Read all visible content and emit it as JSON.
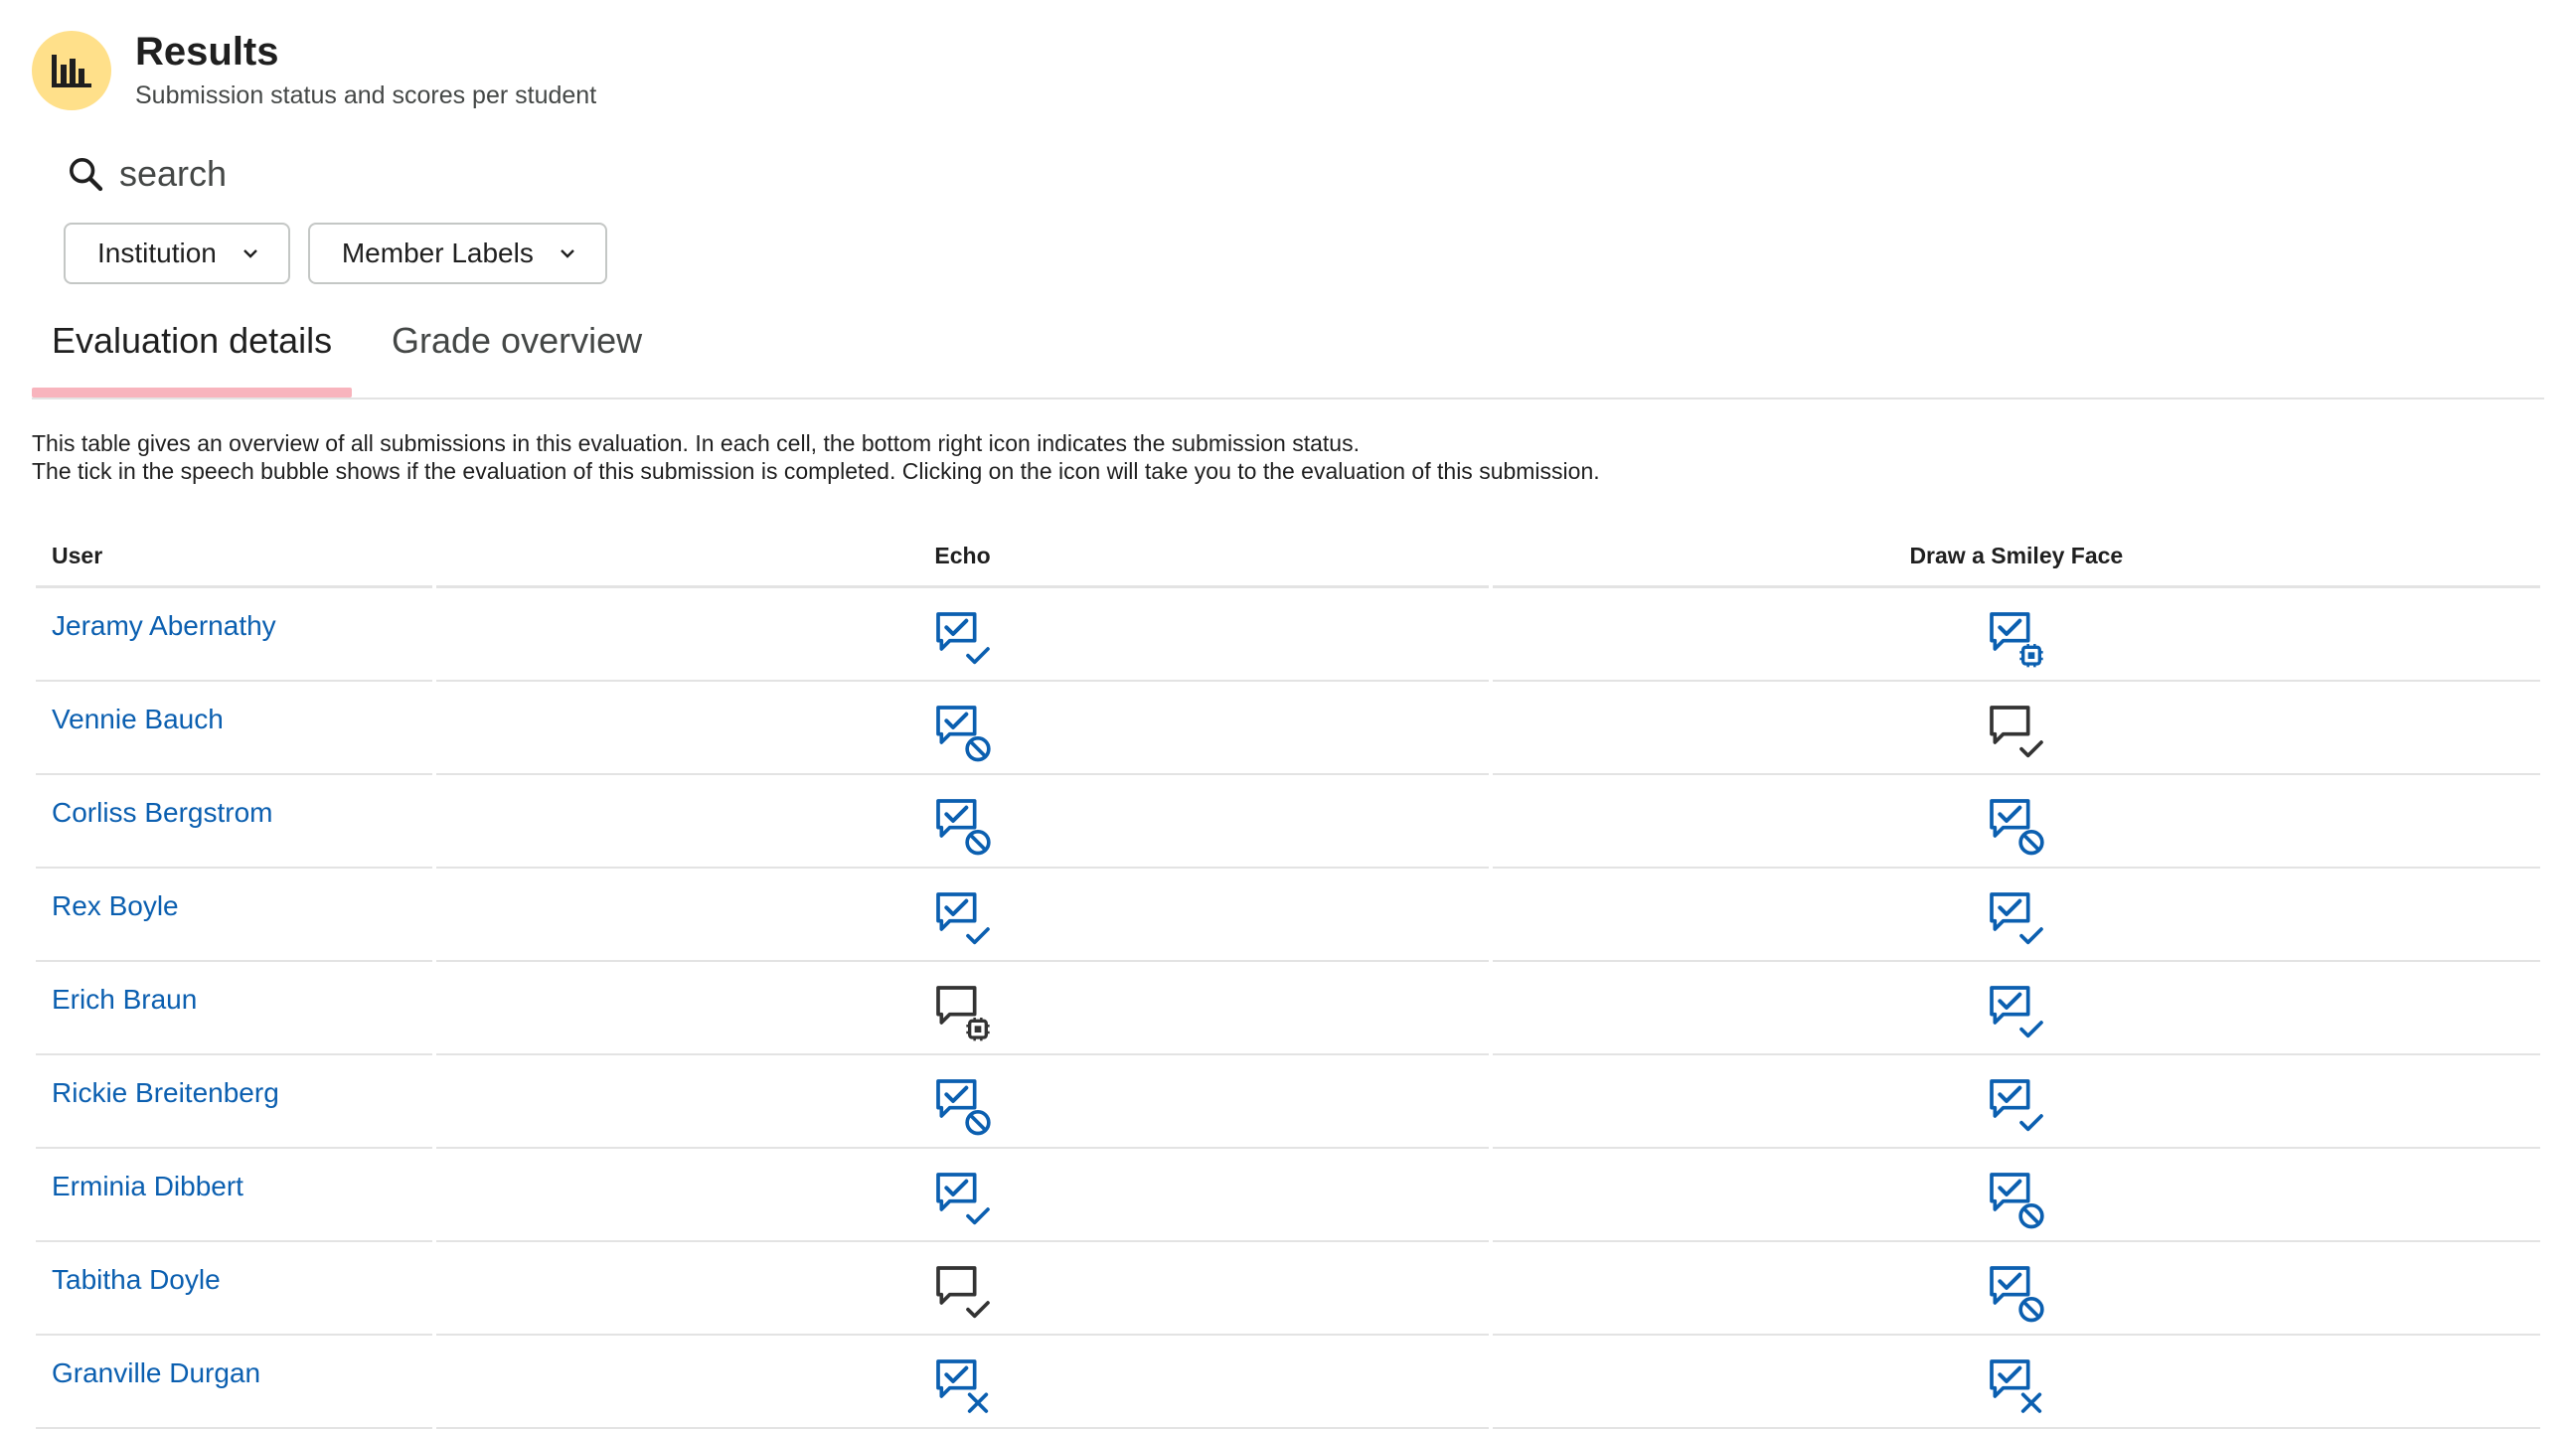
{
  "header": {
    "title": "Results",
    "subtitle": "Submission status and scores per student",
    "icon": "bar-chart-icon",
    "icon_bg": "#ffe08a"
  },
  "search": {
    "placeholder": "search"
  },
  "filters": [
    {
      "label": "Institution"
    },
    {
      "label": "Member Labels"
    }
  ],
  "tabs": [
    {
      "label": "Evaluation details",
      "active": true
    },
    {
      "label": "Grade overview",
      "active": false
    }
  ],
  "description": {
    "line1": "This table gives an overview of all submissions in this evaluation. In each cell, the bottom right icon indicates the submission status.",
    "line2": "The tick in the speech bubble shows if the evaluation of this submission is completed. Clicking on the icon will take you to the evaluation of this submission."
  },
  "table": {
    "columns": [
      "User",
      "Echo",
      "Draw a Smiley Face"
    ],
    "rows": [
      {
        "user": "Jeramy Abernathy",
        "echo": {
          "completed": true,
          "status": "correct"
        },
        "draw": {
          "completed": true,
          "status": "running"
        }
      },
      {
        "user": "Vennie Bauch",
        "echo": {
          "completed": true,
          "status": "blocked"
        },
        "draw": {
          "completed": false,
          "status": "correct"
        }
      },
      {
        "user": "Corliss Bergstrom",
        "echo": {
          "completed": true,
          "status": "blocked"
        },
        "draw": {
          "completed": true,
          "status": "blocked"
        }
      },
      {
        "user": "Rex Boyle",
        "echo": {
          "completed": true,
          "status": "correct"
        },
        "draw": {
          "completed": true,
          "status": "correct"
        }
      },
      {
        "user": "Erich Braun",
        "echo": {
          "completed": false,
          "status": "running"
        },
        "draw": {
          "completed": true,
          "status": "correct"
        }
      },
      {
        "user": "Rickie Breitenberg",
        "echo": {
          "completed": true,
          "status": "blocked"
        },
        "draw": {
          "completed": true,
          "status": "correct"
        }
      },
      {
        "user": "Erminia Dibbert",
        "echo": {
          "completed": true,
          "status": "correct"
        },
        "draw": {
          "completed": true,
          "status": "blocked"
        }
      },
      {
        "user": "Tabitha Doyle",
        "echo": {
          "completed": false,
          "status": "correct"
        },
        "draw": {
          "completed": true,
          "status": "blocked"
        }
      },
      {
        "user": "Granville Durgan",
        "echo": {
          "completed": true,
          "status": "wrong"
        },
        "draw": {
          "completed": true,
          "status": "wrong"
        }
      }
    ]
  },
  "colors": {
    "accent_blue": "#0b5fb0",
    "icon_dark": "#333333",
    "tab_indicator": "#f8b4bd",
    "divider": "#e3e3e3"
  }
}
